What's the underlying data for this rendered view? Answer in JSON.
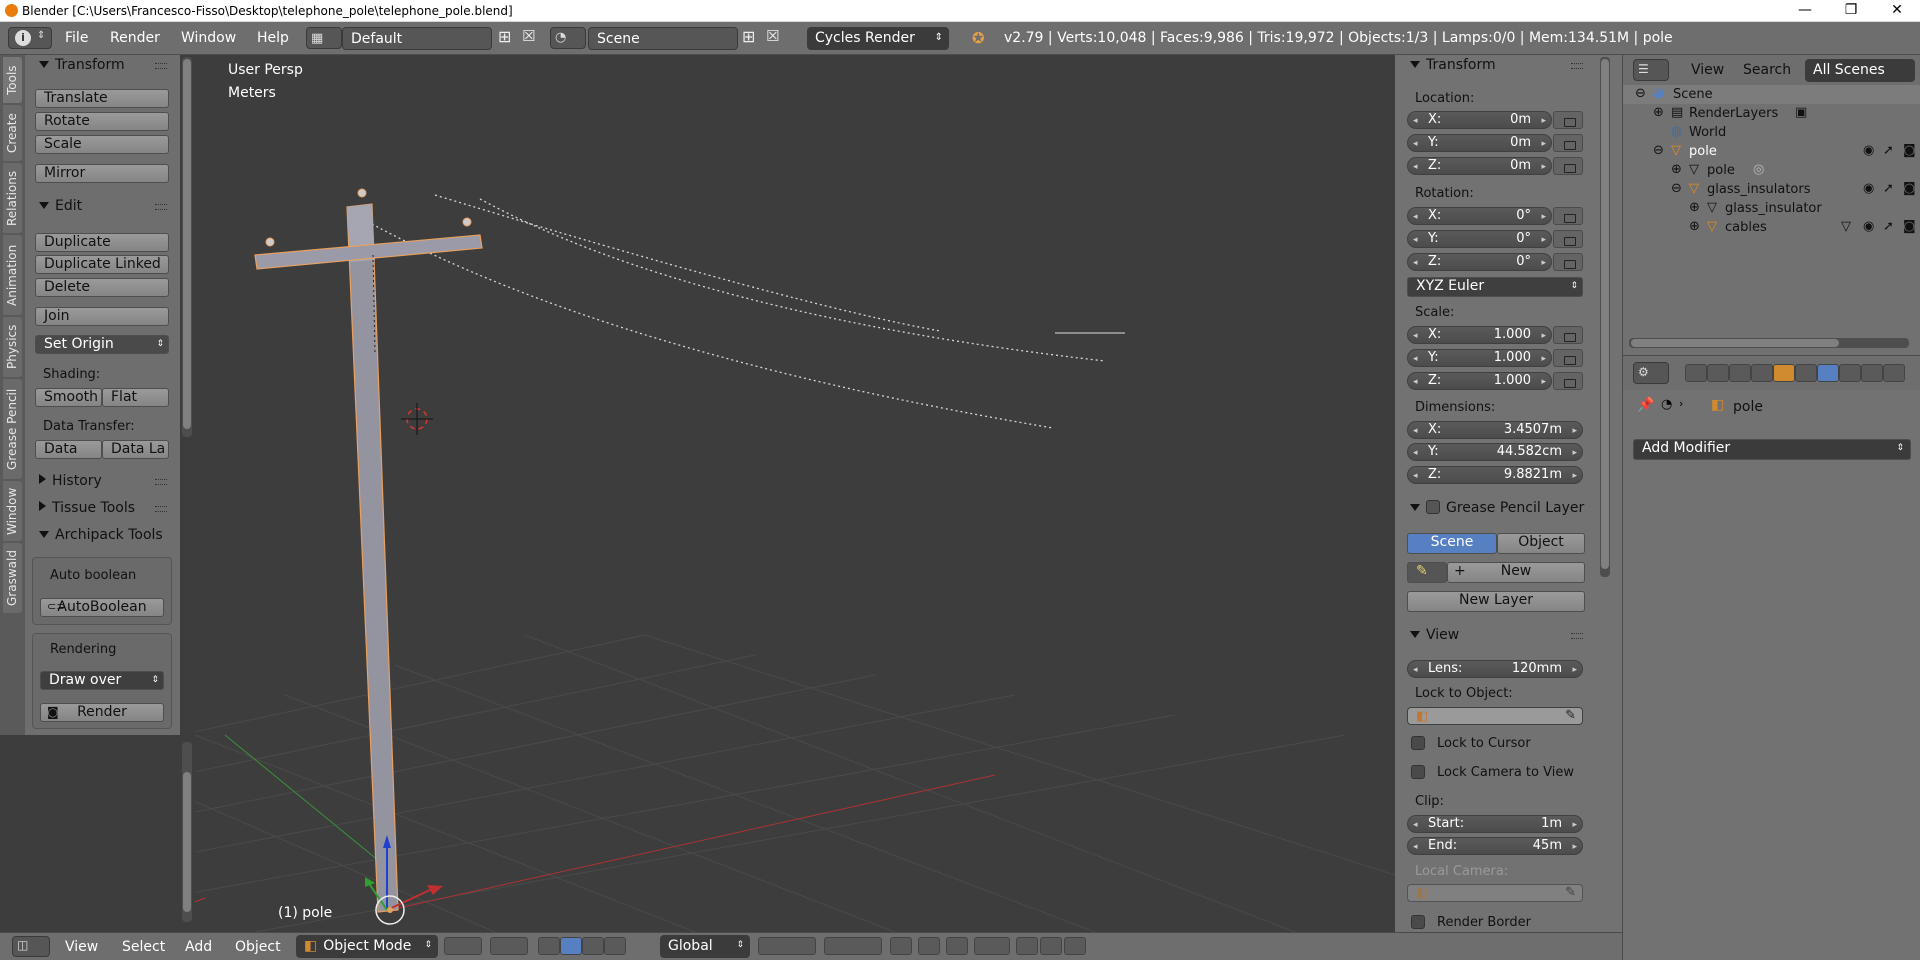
{
  "window": {
    "title": "Blender [C:\\Users\\Francesco-Fisso\\Desktop\\telephone_pole\\telephone_pole.blend]",
    "controls": {
      "minimize": "—",
      "restore": "❐",
      "close": "✕"
    }
  },
  "topbar": {
    "menus": [
      "File",
      "Render",
      "Window",
      "Help"
    ],
    "screen_layout": "Default",
    "scene": "Scene",
    "engine": "Cycles Render",
    "stats": "v2.79 | Verts:10,048 | Faces:9,986 | Tris:19,972 | Objects:1/3 | Lamps:0/0 | Mem:134.51M | pole"
  },
  "tool_tabs": [
    "Tools",
    "Create",
    "Relations",
    "Animation",
    "Physics",
    "Grease Pencil",
    "Window",
    "Graswald"
  ],
  "tools": {
    "transform": {
      "header": "Transform",
      "buttons": [
        "Translate",
        "Rotate",
        "Scale",
        "Mirror"
      ]
    },
    "edit": {
      "header": "Edit",
      "buttons": [
        "Duplicate",
        "Duplicate Linked",
        "Delete",
        "Join"
      ],
      "set_origin": "Set Origin",
      "shading_label": "Shading:",
      "shading": [
        "Smooth",
        "Flat"
      ],
      "data_transfer_label": "Data Transfer:",
      "data_transfer": [
        "Data",
        "Data La"
      ]
    },
    "history": "History",
    "tissue": "Tissue Tools",
    "archipack": "Archipack Tools",
    "autoboolean": {
      "title": "Auto boolean",
      "button": "AutoBoolean"
    },
    "rendering": {
      "title": "Rendering",
      "select": "Draw over",
      "button": "Render"
    }
  },
  "viewport": {
    "view_name": "User Persp",
    "units": "Meters",
    "object_label": "(1) pole"
  },
  "properties_panel": {
    "transform_header": "Transform",
    "location_label": "Location:",
    "location": [
      {
        "k": "X:",
        "v": "0m"
      },
      {
        "k": "Y:",
        "v": "0m"
      },
      {
        "k": "Z:",
        "v": "0m"
      }
    ],
    "rotation_label": "Rotation:",
    "rotation": [
      {
        "k": "X:",
        "v": "0°"
      },
      {
        "k": "Y:",
        "v": "0°"
      },
      {
        "k": "Z:",
        "v": "0°"
      }
    ],
    "rotation_mode": "XYZ Euler",
    "scale_label": "Scale:",
    "scale": [
      {
        "k": "X:",
        "v": "1.000"
      },
      {
        "k": "Y:",
        "v": "1.000"
      },
      {
        "k": "Z:",
        "v": "1.000"
      }
    ],
    "dimensions_label": "Dimensions:",
    "dimensions": [
      {
        "k": "X:",
        "v": "3.4507m"
      },
      {
        "k": "Y:",
        "v": "44.582cm"
      },
      {
        "k": "Z:",
        "v": "9.8821m"
      }
    ],
    "grease_header": "Grease Pencil Layer",
    "grease_tabs": [
      "Scene",
      "Object"
    ],
    "grease_new": "New",
    "grease_new_layer": "New Layer",
    "view_header": "View",
    "lens_label": "Lens:",
    "lens_value": "120mm",
    "lock_object_label": "Lock to Object:",
    "lock_cursor": "Lock to Cursor",
    "lock_camera": "Lock Camera to View",
    "clip_label": "Clip:",
    "clip_start_label": "Start:",
    "clip_start": "1m",
    "clip_end_label": "End:",
    "clip_end": "45m",
    "local_camera": "Local Camera:",
    "render_border": "Render Border"
  },
  "outliner": {
    "menus": [
      "View",
      "Search"
    ],
    "filter": "All Scenes",
    "rows": [
      "Scene",
      "RenderLayers",
      "World",
      "pole",
      "pole",
      "glass_insulators",
      "glass_insulator",
      "cables"
    ]
  },
  "properties_editor": {
    "object_name": "pole",
    "add_modifier": "Add Modifier"
  },
  "bottombar": {
    "menus": [
      "View",
      "Select",
      "Add",
      "Object"
    ],
    "mode": "Object Mode",
    "orientation": "Global"
  },
  "colors": {
    "selection_orange": "#e8a060",
    "active_blue": "#5680c2",
    "x_axis": "#c03030",
    "y_axis": "#30a030",
    "z_axis": "#2040d0"
  }
}
